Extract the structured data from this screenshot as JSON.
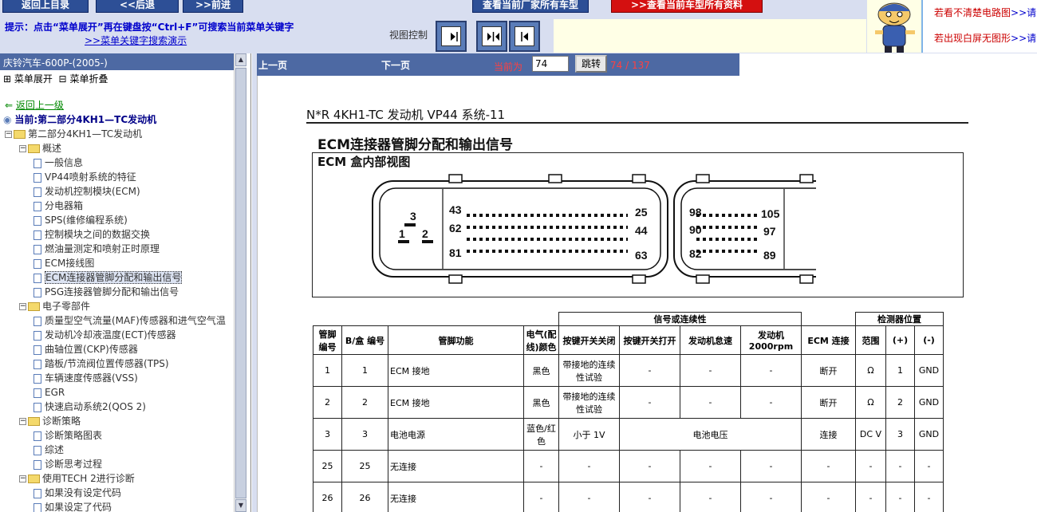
{
  "toolbar": {
    "btn_home": "返回上目录",
    "btn_back": "<<后退",
    "btn_forward": ">>前进",
    "btn_view_all": "查看当前厂家所有车型",
    "btn_view_model": ">>查看当前车型所有资料"
  },
  "hint": {
    "text": "提示：点击“菜单展开”再在键盘按“Ctrl+F”可搜索当前菜单关键字",
    "link": ">>菜单关键字搜索演示"
  },
  "view_control": {
    "label": "视图控制"
  },
  "promo": {
    "line1": "若看不清楚电路图",
    "line1_link": ">>请",
    "line2": "若出现白屏无图形",
    "line2_link": ">>请"
  },
  "sidebar": {
    "title": "庆铃汽车-600P-(2005-)",
    "expand": "菜单展开",
    "collapse": "菜单折叠",
    "back": "返回上一级",
    "current": "当前:第二部分4KH1—TC发动机",
    "tree": [
      {
        "label": "第二部分4KH1—TC发动机",
        "type": "folder",
        "toggle": "⊟"
      },
      {
        "label": "概述",
        "type": "folder",
        "toggle": "⊟"
      },
      {
        "label": "一般信息",
        "type": "page"
      },
      {
        "label": "VP44喷射系统的特征",
        "type": "page"
      },
      {
        "label": "发动机控制模块(ECM)",
        "type": "page"
      },
      {
        "label": "分电器箱",
        "type": "page"
      },
      {
        "label": "SPS(维修编程系统)",
        "type": "page"
      },
      {
        "label": "控制模块之间的数据交换",
        "type": "page"
      },
      {
        "label": "燃油量测定和喷射正时原理",
        "type": "page"
      },
      {
        "label": "ECM接线图",
        "type": "page"
      },
      {
        "label": "ECM连接器管脚分配和输出信号",
        "type": "page"
      },
      {
        "label": "PSG连接器管脚分配和输出信号",
        "type": "page"
      },
      {
        "label": "电子零部件",
        "type": "folder",
        "toggle": "⊟"
      },
      {
        "label": "质量型空气流量(MAF)传感器和进气空气温",
        "type": "page"
      },
      {
        "label": "发动机冷却液温度(ECT)传感器",
        "type": "page"
      },
      {
        "label": "曲轴位置(CKP)传感器",
        "type": "page"
      },
      {
        "label": "踏板/节流阀位置传感器(TPS)",
        "type": "page"
      },
      {
        "label": "车辆速度传感器(VSS)",
        "type": "page"
      },
      {
        "label": "EGR",
        "type": "page"
      },
      {
        "label": "快速启动系统2(QOS 2)",
        "type": "page"
      },
      {
        "label": "诊断策略",
        "type": "folder",
        "toggle": "⊟"
      },
      {
        "label": "诊断策略图表",
        "type": "page"
      },
      {
        "label": "综述",
        "type": "page"
      },
      {
        "label": "诊断思考过程",
        "type": "page"
      },
      {
        "label": "使用TECH 2进行诊断",
        "type": "folder",
        "toggle": "⊟"
      },
      {
        "label": "如果没有设定代码",
        "type": "page"
      },
      {
        "label": "如果设定了代码",
        "type": "page"
      }
    ]
  },
  "pager": {
    "prev": "上一页",
    "next": "下一页",
    "current_label": "当前为",
    "page_value": "74",
    "go": "跳转",
    "count": "74 / 137"
  },
  "document": {
    "header": "N*R 4KH1-TC 发动机 VP44 系统-11",
    "title": "ECM连接器管脚分配和输出信号",
    "subtitle": "ECM 盒内部视图",
    "conn_a": {
      "n3": "3",
      "n1": "1",
      "n2": "2",
      "n43": "43",
      "n25": "25",
      "n62": "62",
      "n44": "44",
      "n81": "81",
      "n63": "63"
    },
    "conn_b": {
      "n98": "98",
      "n105": "105",
      "n90": "90",
      "n97": "97",
      "n82": "82",
      "n89": "89"
    },
    "table": {
      "group_signal": "信号或连续性",
      "group_tester": "检测器位置",
      "headers": [
        "管脚编号",
        "B/盒 编号",
        "管脚功能",
        "电气(配线)颜色",
        "按键开关关闭",
        "按键开关打开",
        "发动机怠速",
        "发动机2000rpm",
        "ECM 连接",
        "范围",
        "(+)",
        "(-)"
      ],
      "rows": [
        [
          "1",
          "1",
          "ECM 接地",
          "黑色",
          "带接地的连续性试验",
          "-",
          "-",
          "-",
          "断开",
          "Ω",
          "1",
          "GND"
        ],
        [
          "2",
          "2",
          "ECM 接地",
          "黑色",
          "带接地的连续性试验",
          "-",
          "-",
          "-",
          "断开",
          "Ω",
          "2",
          "GND"
        ],
        [
          "3",
          "3",
          "电池电源",
          "蓝色/红色",
          "小于 1V",
          "电池电压",
          "",
          "",
          "连接",
          "DC V",
          "3",
          "GND"
        ],
        [
          "25",
          "25",
          "无连接",
          "-",
          "-",
          "-",
          "-",
          "-",
          "-",
          "-",
          "-",
          "-"
        ],
        [
          "26",
          "26",
          "无连接",
          "-",
          "-",
          "-",
          "-",
          "-",
          "-",
          "-",
          "-",
          "-"
        ]
      ]
    }
  },
  "colors": {
    "nav_blue": "#4d69a3",
    "toolbar_blue": "#2d4f96",
    "alert_red": "#d41010",
    "link_blue": "#0000cc"
  }
}
